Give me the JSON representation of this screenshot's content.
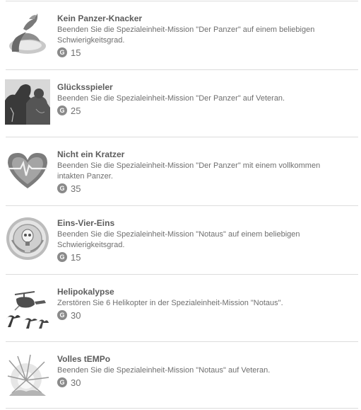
{
  "achievements": [
    {
      "title": "Kein Panzer-Knacker",
      "description": "Beenden Sie die Spezialeinheit-Mission \"Der Panzer\" auf einem beliebigen Schwierigkeitsgrad.",
      "points": "15",
      "icon": "lion-emblem-icon"
    },
    {
      "title": "Glücksspieler",
      "description": "Beenden Sie die Spezialeinheit-Mission \"Der Panzer\" auf Veteran.",
      "points": "25",
      "icon": "soldiers-silhouette-icon"
    },
    {
      "title": "Nicht ein Kratzer",
      "description": "Beenden Sie die Spezialeinheit-Mission \"Der Panzer\" mit einem vollkommen intakten Panzer.",
      "points": "35",
      "icon": "heartbeat-heart-icon"
    },
    {
      "title": "Eins-Vier-Eins",
      "description": "Beenden Sie die Spezialeinheit-Mission \"Notaus\" auf einem beliebigen Schwierigkeitsgrad.",
      "points": "15",
      "icon": "skull-seal-icon"
    },
    {
      "title": "Helipokalypse",
      "description": "Zerstören Sie 6 Helikopter in der Spezialeinheit-Mission \"Notaus\".",
      "points": "30",
      "icon": "helicopter-palms-icon"
    },
    {
      "title": "Volles tEMPo",
      "description": "Beenden Sie die Spezialeinheit-Mission \"Notaus\" auf Veteran.",
      "points": "30",
      "icon": "emp-burst-icon"
    }
  ],
  "gamerscore_badge": "G"
}
